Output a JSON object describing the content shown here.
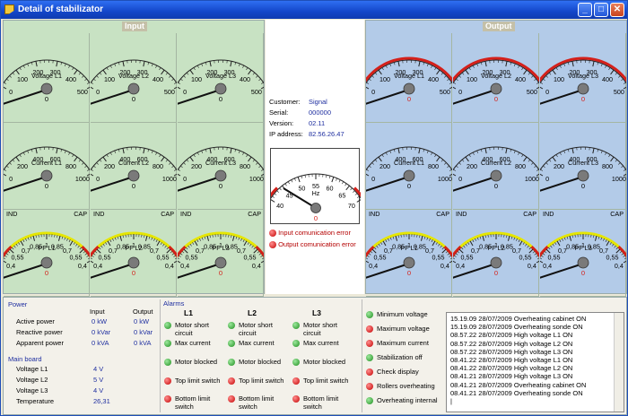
{
  "window": {
    "title": "Detail of stabilizator",
    "buttons": [
      "minimize",
      "maximize",
      "close"
    ]
  },
  "input_title": "Input",
  "output_title": "Output",
  "colors": {
    "input_bg": "#c8e2c3",
    "output_bg": "#b3cbe8",
    "needle": "#111",
    "warn": "#d4201a",
    "pf_band": "#e6e600"
  },
  "input": [
    {
      "label": "Voltage L1",
      "value": "0",
      "ticks": [
        "0",
        "100",
        "200",
        "300",
        "400",
        "500"
      ],
      "frac": 0
    },
    {
      "label": "Voltage L2",
      "value": "0",
      "ticks": [
        "0",
        "100",
        "200",
        "300",
        "400",
        "500"
      ],
      "frac": 0
    },
    {
      "label": "Voltage L3",
      "value": "0",
      "ticks": [
        "0",
        "100",
        "200",
        "300",
        "400",
        "500"
      ],
      "frac": 0
    },
    {
      "label": "Current L1",
      "value": "0",
      "ticks": [
        "0",
        "200",
        "400",
        "600",
        "800",
        "1000"
      ],
      "frac": 0
    },
    {
      "label": "Current L2",
      "value": "0",
      "ticks": [
        "0",
        "200",
        "400",
        "600",
        "800",
        "1000"
      ],
      "frac": 0
    },
    {
      "label": "Current L3",
      "value": "0",
      "ticks": [
        "0",
        "200",
        "400",
        "600",
        "800",
        "1000"
      ],
      "frac": 0
    },
    {
      "label": "PF L1",
      "value": "0",
      "pf": true,
      "frac": 0
    },
    {
      "label": "PF L2",
      "value": "0",
      "pf": true,
      "frac": 0
    },
    {
      "label": "PF L3",
      "value": "0",
      "pf": true,
      "frac": 0
    }
  ],
  "output": [
    {
      "label": "Voltage L1",
      "value": "0",
      "ticks": [
        "0",
        "100",
        "200",
        "300",
        "400",
        "500"
      ],
      "frac": 0,
      "red": true
    },
    {
      "label": "Voltage L2",
      "value": "0",
      "ticks": [
        "0",
        "100",
        "200",
        "300",
        "400",
        "500"
      ],
      "frac": 0,
      "red": true
    },
    {
      "label": "Voltage L3",
      "value": "0",
      "ticks": [
        "0",
        "100",
        "200",
        "300",
        "400",
        "500"
      ],
      "frac": 0,
      "red": true
    },
    {
      "label": "Current L1",
      "value": "0",
      "ticks": [
        "0",
        "200",
        "400",
        "600",
        "800",
        "1000"
      ],
      "frac": 0
    },
    {
      "label": "Current L2",
      "value": "0",
      "ticks": [
        "0",
        "200",
        "400",
        "600",
        "800",
        "1000"
      ],
      "frac": 0
    },
    {
      "label": "Current L3",
      "value": "0",
      "ticks": [
        "0",
        "200",
        "400",
        "600",
        "800",
        "1000"
      ],
      "frac": 0
    },
    {
      "label": "PF L1",
      "value": "0",
      "pf": true,
      "frac": 0
    },
    {
      "label": "PF L2",
      "value": "0",
      "pf": true,
      "frac": 0
    },
    {
      "label": "PF L3",
      "value": "0",
      "pf": true,
      "frac": 0
    }
  ],
  "pf_scale": {
    "ind": "IND",
    "cap": "CAP",
    "ticks": [
      "0,4",
      "0,55",
      "0,7",
      "0,85",
      "1",
      "0,85",
      "0,7",
      "0,55",
      "0,4"
    ]
  },
  "device": {
    "customer_label": "Customer:",
    "customer": "Signal",
    "serial_label": "Serial:",
    "serial": "000000",
    "version_label": "Version:",
    "version": "02.11",
    "ip_label": "IP address:",
    "ip": "82.56.26.47"
  },
  "hz_gauge": {
    "label": "Hz",
    "value": "0",
    "ticks": [
      "40",
      "45",
      "50",
      "55",
      "60",
      "65",
      "70"
    ],
    "frac": 0
  },
  "errors": [
    "Input comunication error",
    "Output comunication error"
  ],
  "power": {
    "title": "Power",
    "col_input": "Input",
    "col_output": "Output",
    "rows": [
      {
        "label": "Active power",
        "input": "0 kW",
        "output": "0 kW"
      },
      {
        "label": "Reactive power",
        "input": "0 kVar",
        "output": "0 kVar"
      },
      {
        "label": "Apparent power",
        "input": "0 kVA",
        "output": "0 kVA"
      }
    ]
  },
  "main_board": {
    "title": "Main board",
    "rows": [
      {
        "label": "Voltage L1",
        "value": "4 V"
      },
      {
        "label": "Voltage L2",
        "value": "5 V"
      },
      {
        "label": "Voltage L3",
        "value": "4 V"
      },
      {
        "label": "Temperature",
        "value": "26,31"
      }
    ]
  },
  "alarms": {
    "title": "Alarms",
    "columns": [
      {
        "header": "L1",
        "items": [
          {
            "text": "Motor short circuit",
            "state": "green"
          },
          {
            "text": "Max current",
            "state": "green"
          },
          {
            "text": "Motor blocked",
            "state": "green"
          },
          {
            "text": "Top limit switch",
            "state": "red"
          },
          {
            "text": "Bottom limit switch",
            "state": "red"
          }
        ]
      },
      {
        "header": "L2",
        "items": [
          {
            "text": "Motor short circuit",
            "state": "green"
          },
          {
            "text": "Max current",
            "state": "green"
          },
          {
            "text": "Motor blocked",
            "state": "green"
          },
          {
            "text": "Top limit switch",
            "state": "red"
          },
          {
            "text": "Bottom limit switch",
            "state": "red"
          }
        ]
      },
      {
        "header": "L3",
        "items": [
          {
            "text": "Motor short circuit",
            "state": "green"
          },
          {
            "text": "Max current",
            "state": "green"
          },
          {
            "text": "Motor blocked",
            "state": "green"
          },
          {
            "text": "Top limit switch",
            "state": "red"
          },
          {
            "text": "Bottom limit switch",
            "state": "red"
          }
        ]
      }
    ],
    "general": [
      {
        "text": "Minimum voltage",
        "state": "green"
      },
      {
        "text": "Maximum voltage",
        "state": "red"
      },
      {
        "text": "Maximum current",
        "state": "red"
      },
      {
        "text": "Stabilization off",
        "state": "green"
      },
      {
        "text": "Check display",
        "state": "red"
      },
      {
        "text": "Rollers overheating",
        "state": "red"
      },
      {
        "text": "Overheating internal",
        "state": "green"
      }
    ]
  },
  "log": [
    "15.19.09 28/07/2009 Overheating cabinet ON",
    "15.19.09 28/07/2009 Overheating sonde ON",
    "08.57.22 28/07/2009 High voltage L1 ON",
    "08.57.22 28/07/2009 High voltage L2 ON",
    "08.57.22 28/07/2009 High voltage L3 ON",
    "08.41.22 28/07/2009 High voltage L1 ON",
    "08.41.22 28/07/2009 High voltage L2 ON",
    "08.41.21 28/07/2009 High voltage L3 ON",
    "08.41.21 28/07/2009 Overheating cabinet ON",
    "08.41.21 28/07/2009 Overheating sonde ON"
  ]
}
